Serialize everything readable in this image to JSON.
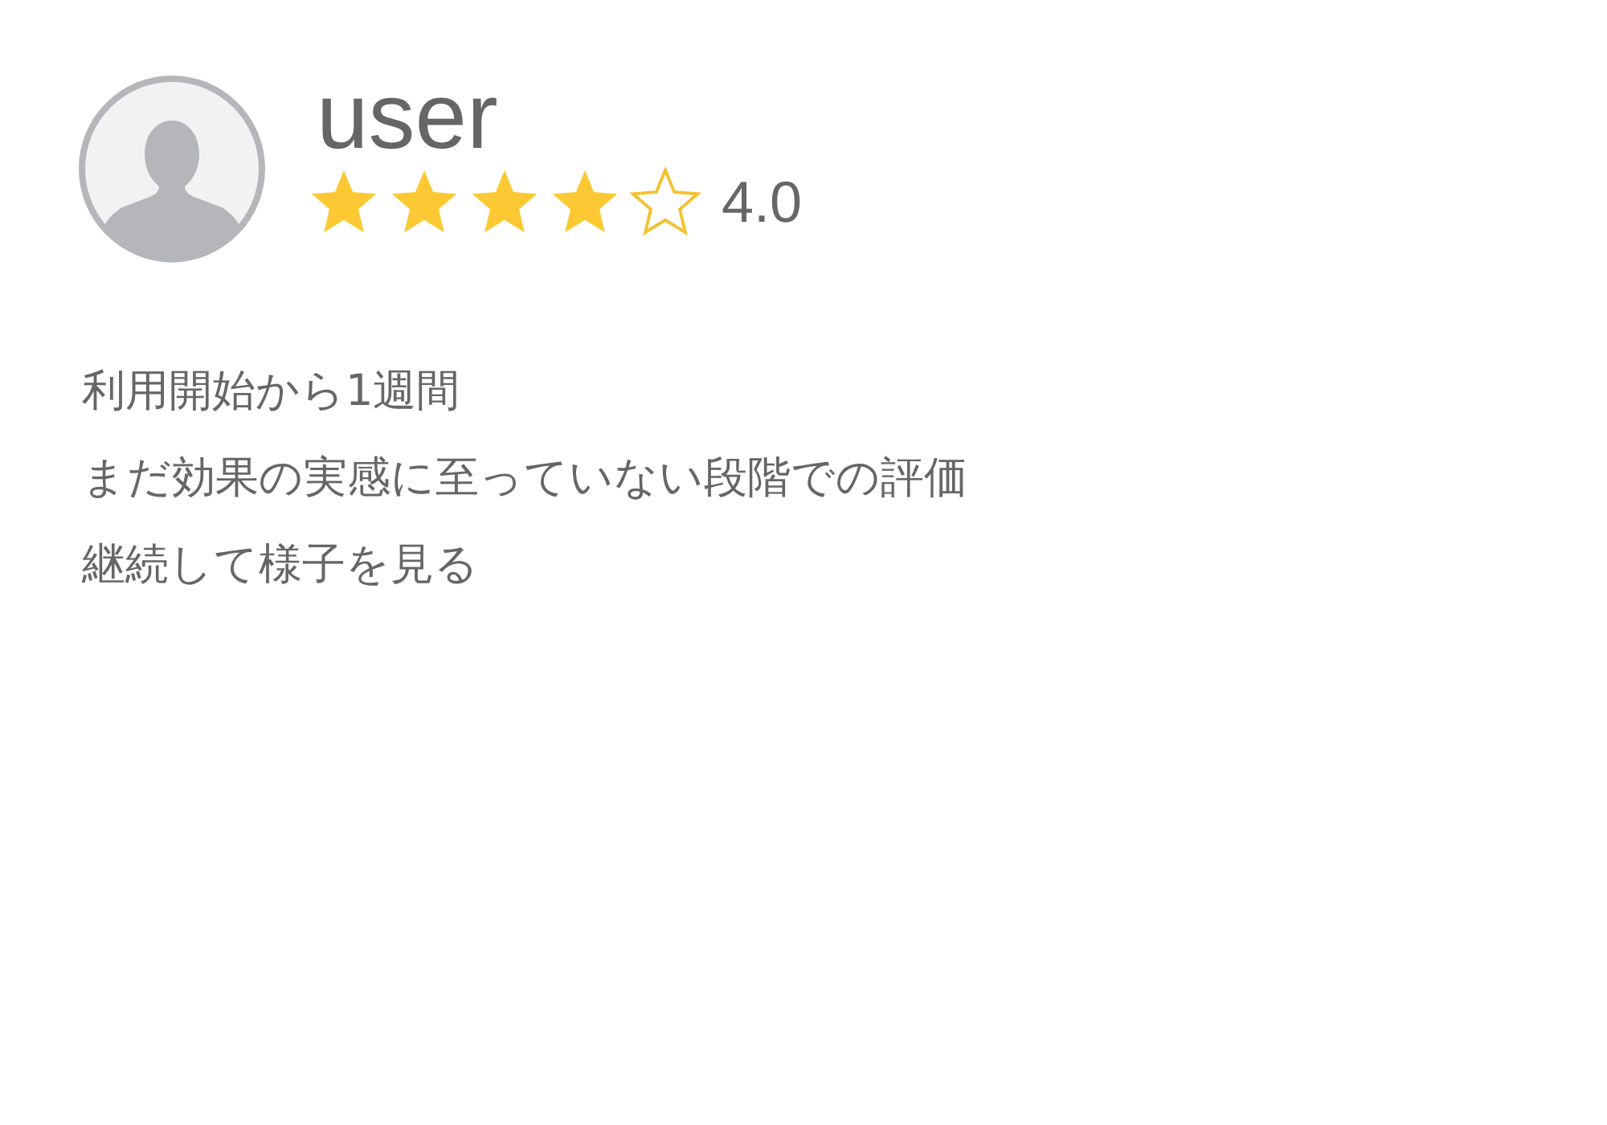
{
  "review": {
    "user": "user",
    "stars": 4,
    "rating": "4.0",
    "lines": [
      "利用開始から1週間",
      "まだ効果の実感に至っていない段階での評価",
      "継続して様子を見る"
    ]
  }
}
